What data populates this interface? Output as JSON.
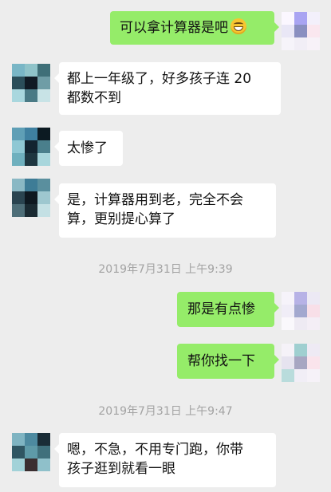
{
  "messages": [
    {
      "id": "m1",
      "side": "out",
      "lines": [
        "可以拿计算器是吧"
      ],
      "emoji": "grinning-face"
    },
    {
      "id": "m2",
      "side": "in",
      "lines": [
        "都上一年级了，好多孩子连 20",
        "都数不到"
      ]
    },
    {
      "id": "m3",
      "side": "in",
      "lines": [
        "太惨了"
      ]
    },
    {
      "id": "m4",
      "side": "in",
      "lines": [
        "是，计算器用到老，完全不会",
        "算，更别提心算了"
      ]
    },
    {
      "id": "t1",
      "type": "time",
      "text": "2019年7月31日 上午9:39"
    },
    {
      "id": "m5",
      "side": "out",
      "lines": [
        "那是有点惨"
      ]
    },
    {
      "id": "m6",
      "side": "out",
      "lines": [
        "帮你找一下"
      ]
    },
    {
      "id": "t2",
      "type": "time",
      "text": "2019年7月31日 上午9:47"
    },
    {
      "id": "m7",
      "side": "in",
      "lines": [
        "嗯，不急，不用专门跑，你带",
        "孩子逛到就看一眼"
      ]
    }
  ],
  "colors": {
    "background": "#ededed",
    "incoming_bubble": "#ffffff",
    "outgoing_bubble": "#95ec69",
    "timestamp_text": "#a3a3a3"
  },
  "avatars": {
    "self": [
      "#fbf7ff",
      "#a9a4f2",
      "#f3f0fb",
      "#e9e7f6",
      "#8a8fc0",
      "#fae7ef",
      "#f6f4fa",
      "#f1eef6",
      "#f7f2f8"
    ],
    "other": [
      "#79b6c6",
      "#8fc3c9",
      "#3f6f78",
      "#2b4e5a",
      "#101a24",
      "#6f9da6",
      "#a9d7de",
      "#4a7a85",
      "#c8e3e6"
    ]
  }
}
